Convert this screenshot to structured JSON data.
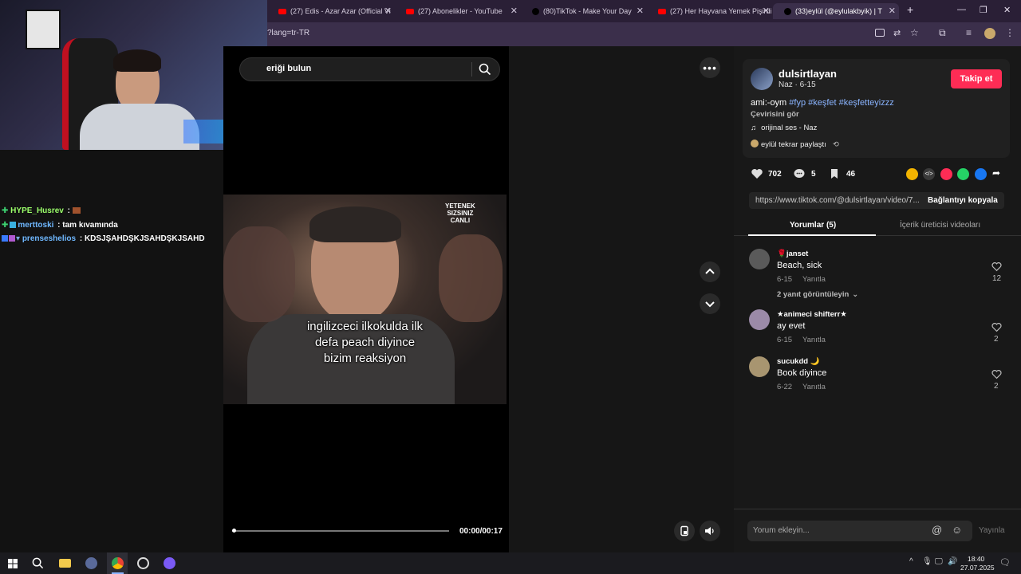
{
  "browser": {
    "tabs": [
      {
        "label": "(27) Edis - Azar Azar (Official Vi",
        "icon": "youtube-icon"
      },
      {
        "label": "(27) Abonelikler - YouTube",
        "icon": "youtube-icon"
      },
      {
        "label": "(80)TikTok - Make Your Day",
        "icon": "tiktok-icon"
      },
      {
        "label": "(27) Her Hayvana Yemek Pişirdi",
        "icon": "youtube-icon"
      },
      {
        "label": "(33)eylül (@eylulakbyik) | T",
        "icon": "tiktok-icon"
      }
    ],
    "url_fragment": "?lang=tr-TR"
  },
  "chat": [
    {
      "user": "HYPE_Husrev",
      "text": " : ",
      "color": "#9bff6a"
    },
    {
      "user": "merttoski",
      "text": " : tam kıvamında",
      "color": "#6fb8ff"
    },
    {
      "user": "prenseshelios",
      "text": " : KDSJŞAHDŞKJSAHDŞKJSAHD",
      "color": "#6fb8ff"
    }
  ],
  "search": {
    "text": "eriği bulun"
  },
  "video": {
    "caption_lines": [
      "ingilizceci ilkokulda ilk",
      "defa peach diyince",
      "bizim reaksiyon"
    ],
    "time": "00:00/00:17",
    "progress": 0.0
  },
  "post": {
    "username": "dulsirtlayan",
    "subline": "Naz · 6-15",
    "follow_label": "Takip et",
    "desc_prefix": "ami:-oym ",
    "hashtags": "#fyp #keşfet #keşfetteyizzz",
    "translate_label": "Çevirisini gör",
    "music": "orijinal ses - Naz",
    "reposted_by": "eylül tekrar paylaştı",
    "likes": "702",
    "comments": "5",
    "saves": "46",
    "link": "https://www.tiktok.com/@dulsirtlayan/video/7...",
    "copy_link_label": "Bağlantıyı kopyala"
  },
  "panel_tabs": {
    "comments": "Yorumlar (5)",
    "creator_videos": "İçerik üreticisi videoları"
  },
  "comments": [
    {
      "user": "🌹janset",
      "text": "Beach, sick",
      "date": "6-15",
      "reply": "Yanıtla",
      "likes": "12",
      "avatar_color": "#5a5a5a"
    },
    {
      "user": "★animeci shifterr★",
      "text": "ay evet",
      "date": "6-15",
      "reply": "Yanıtla",
      "likes": "2",
      "avatar_color": "#9b8aa8"
    },
    {
      "user": "sucukdd 🌙",
      "text": "Book diyince",
      "date": "6-22",
      "reply": "Yanıtla",
      "likes": "2",
      "avatar_color": "#a89570"
    }
  ],
  "view_replies": "2 yanıt görüntüleyin",
  "comment_input": {
    "placeholder": "Yorum ekleyin...",
    "post_label": "Yayınla"
  },
  "taskbar": {
    "time": "18:40",
    "date": "27.07.2025"
  }
}
